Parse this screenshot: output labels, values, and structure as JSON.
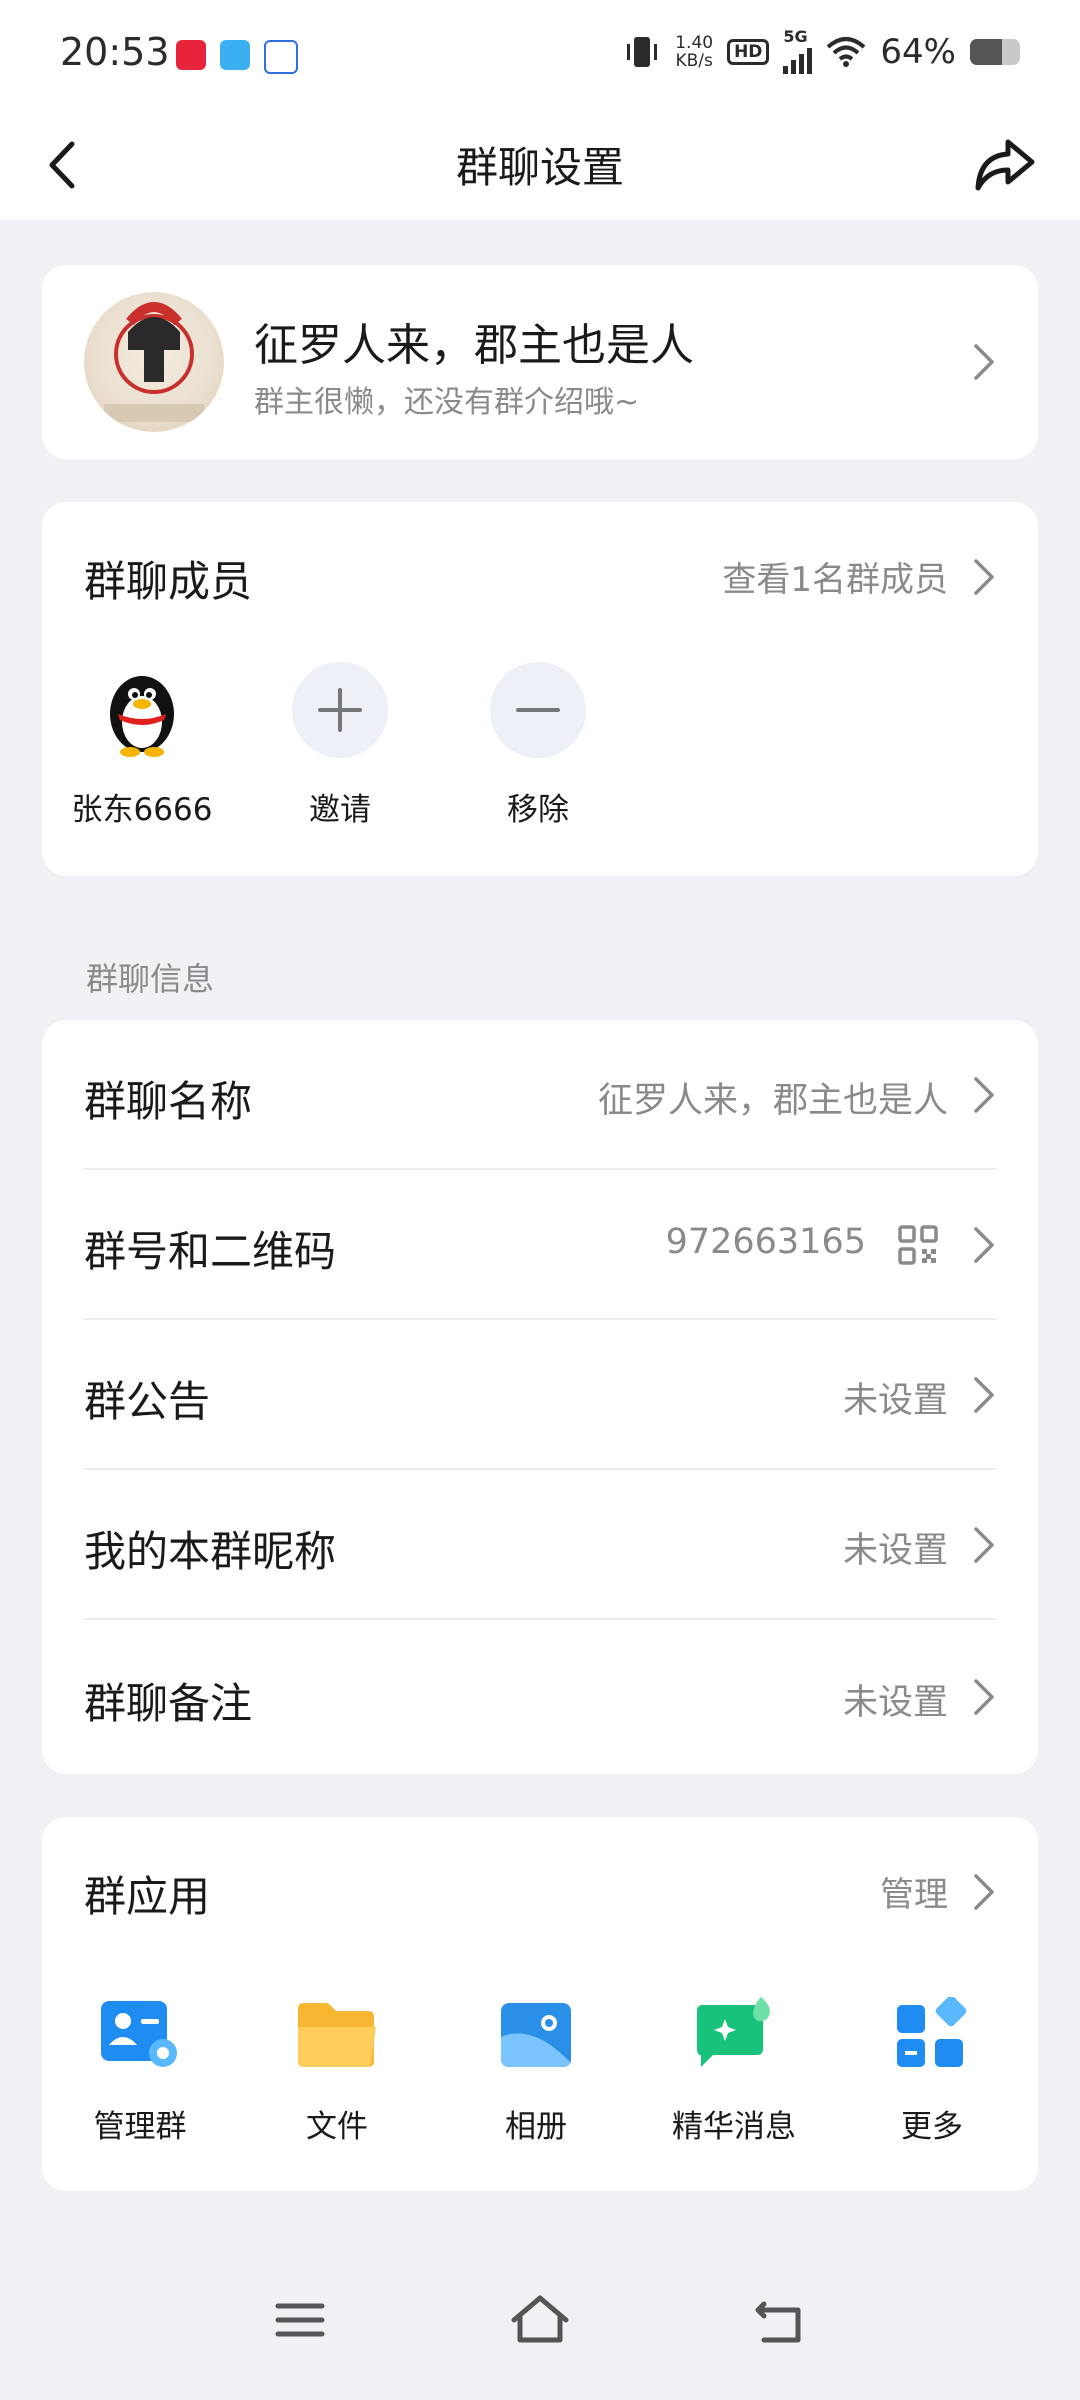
{
  "status_bar": {
    "time": "20:53",
    "net_speed_value": "1.40",
    "net_speed_unit": "KB/s",
    "hd": "HD",
    "network": "5G",
    "battery": "64%",
    "battery_level": 0.64
  },
  "nav": {
    "title": "群聊设置",
    "back_icon": "chevron-left-icon",
    "share_icon": "share-icon"
  },
  "group": {
    "name": "征罗人来，郡主也是人",
    "intro": "群主很懒，还没有群介绍哦~"
  },
  "members": {
    "title": "群聊成员",
    "view_all": "查看1名群成员",
    "items": [
      {
        "label": "张东6666",
        "icon": "penguin-avatar-icon"
      },
      {
        "label": "邀请",
        "icon": "plus-icon"
      },
      {
        "label": "移除",
        "icon": "minus-icon"
      }
    ]
  },
  "info": {
    "section_label": "群聊信息",
    "rows": [
      {
        "label": "群聊名称",
        "value": "征罗人来，郡主也是人"
      },
      {
        "label": "群号和二维码",
        "value": "972663165"
      },
      {
        "label": "群公告",
        "value": "未设置"
      },
      {
        "label": "我的本群昵称",
        "value": "未设置"
      },
      {
        "label": "群聊备注",
        "value": "未设置"
      }
    ]
  },
  "apps": {
    "title": "群应用",
    "manage": "管理",
    "items": [
      {
        "label": "管理群",
        "icon": "manage-group-icon",
        "color": "#1e8cf0"
      },
      {
        "label": "文件",
        "icon": "folder-icon",
        "color": "#f7b630"
      },
      {
        "label": "相册",
        "icon": "album-icon",
        "color": "#2a8fe6"
      },
      {
        "label": "精华消息",
        "icon": "highlight-message-icon",
        "color": "#19c27a"
      },
      {
        "label": "更多",
        "icon": "more-apps-icon",
        "color": "#1e8cf0"
      }
    ]
  },
  "bottom_nav": {
    "menu_icon": "menu-icon",
    "home_icon": "home-icon",
    "back_icon": "back-icon"
  }
}
